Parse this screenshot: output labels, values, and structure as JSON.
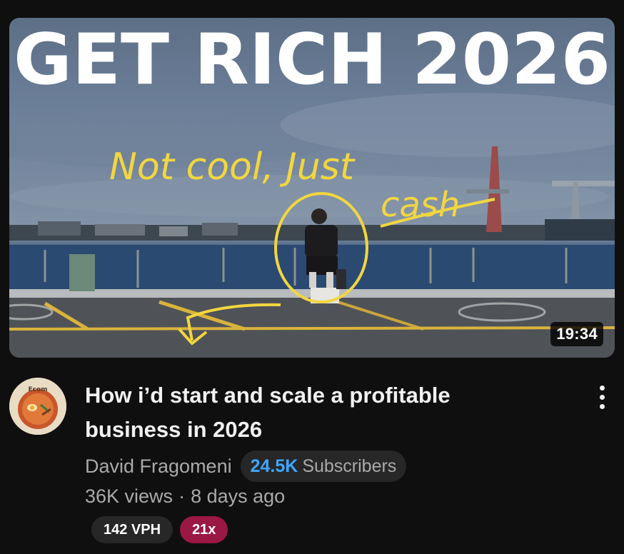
{
  "video": {
    "thumbnail": {
      "headline": "GET RICH 2026",
      "scribble_line1": "Not cool, Just",
      "scribble_line2": "cash",
      "duration": "19:34"
    },
    "title_line1": "How i’d start and scale a profitable",
    "title_line2": "business in 2026",
    "channel": {
      "name": "David Fragomeni",
      "subscribers_count": "24.5K",
      "subscribers_label": "Subscribers",
      "avatar_text": "Ecom"
    },
    "views": "36K views",
    "separator": "·",
    "age": "8 days ago",
    "badges": {
      "vph": "142 VPH",
      "multiplier": "21x"
    },
    "menu_icon": "more-vert-icon"
  },
  "colors": {
    "background": "#0f0f0f",
    "subscriber_count": "#3ea6ff",
    "multiplier_badge": "#9b1744",
    "scribble": "#f2d640"
  }
}
